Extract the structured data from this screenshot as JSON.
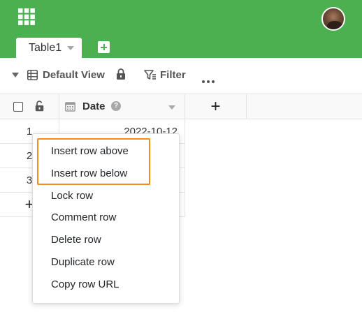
{
  "header": {
    "tab": {
      "label": "Table1"
    },
    "colors": {
      "brand": "#4caf50",
      "highlight": "#f08c1a"
    },
    "icons": [
      "apps-grid-icon",
      "avatar",
      "add-table-icon"
    ]
  },
  "toolbar": {
    "view_name": "Default View",
    "filter_label": "Filter",
    "icons": [
      "collapse-caret-icon",
      "table-view-icon",
      "lock-icon",
      "filter-icon",
      "more-icon"
    ]
  },
  "grid": {
    "columns": [
      {
        "label": "Date",
        "icon": "calendar-icon",
        "help": "?"
      }
    ],
    "add_column_label": "+",
    "rows": [
      {
        "number": "1",
        "date": "2022-10-12"
      },
      {
        "number": "2",
        "date": ""
      },
      {
        "number": "3",
        "date": ""
      }
    ],
    "add_row_label": "+"
  },
  "context_menu": {
    "items": [
      "Insert row above",
      "Insert row below",
      "Lock row",
      "Comment row",
      "Delete row",
      "Duplicate row",
      "Copy row URL"
    ]
  }
}
